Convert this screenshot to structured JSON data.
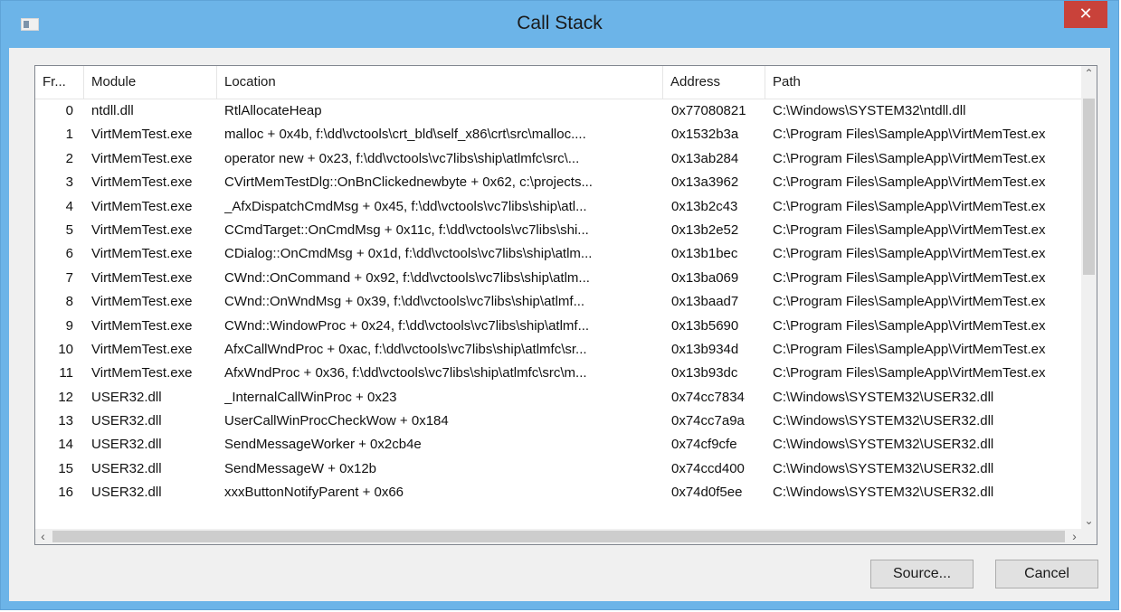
{
  "window": {
    "title": "Call Stack",
    "close_glyph": "✕",
    "icon": "window-app-icon"
  },
  "columns": [
    "Fr...",
    "Module",
    "Location",
    "Address",
    "Path"
  ],
  "rows": [
    {
      "frame": "0",
      "module": "ntdll.dll",
      "location": "RtlAllocateHeap",
      "address": "0x77080821",
      "path": "C:\\Windows\\SYSTEM32\\ntdll.dll"
    },
    {
      "frame": "1",
      "module": "VirtMemTest.exe",
      "location": "malloc + 0x4b, f:\\dd\\vctools\\crt_bld\\self_x86\\crt\\src\\malloc....",
      "address": "0x1532b3a",
      "path": "C:\\Program Files\\SampleApp\\VirtMemTest.ex"
    },
    {
      "frame": "2",
      "module": "VirtMemTest.exe",
      "location": "operator new + 0x23, f:\\dd\\vctools\\vc7libs\\ship\\atlmfc\\src\\...",
      "address": "0x13ab284",
      "path": "C:\\Program Files\\SampleApp\\VirtMemTest.ex"
    },
    {
      "frame": "3",
      "module": "VirtMemTest.exe",
      "location": "CVirtMemTestDlg::OnBnClickednewbyte + 0x62, c:\\projects...",
      "address": "0x13a3962",
      "path": "C:\\Program Files\\SampleApp\\VirtMemTest.ex"
    },
    {
      "frame": "4",
      "module": "VirtMemTest.exe",
      "location": "_AfxDispatchCmdMsg + 0x45, f:\\dd\\vctools\\vc7libs\\ship\\atl...",
      "address": "0x13b2c43",
      "path": "C:\\Program Files\\SampleApp\\VirtMemTest.ex"
    },
    {
      "frame": "5",
      "module": "VirtMemTest.exe",
      "location": "CCmdTarget::OnCmdMsg + 0x11c, f:\\dd\\vctools\\vc7libs\\shi...",
      "address": "0x13b2e52",
      "path": "C:\\Program Files\\SampleApp\\VirtMemTest.ex"
    },
    {
      "frame": "6",
      "module": "VirtMemTest.exe",
      "location": "CDialog::OnCmdMsg + 0x1d, f:\\dd\\vctools\\vc7libs\\ship\\atlm...",
      "address": "0x13b1bec",
      "path": "C:\\Program Files\\SampleApp\\VirtMemTest.ex"
    },
    {
      "frame": "7",
      "module": "VirtMemTest.exe",
      "location": "CWnd::OnCommand + 0x92, f:\\dd\\vctools\\vc7libs\\ship\\atlm...",
      "address": "0x13ba069",
      "path": "C:\\Program Files\\SampleApp\\VirtMemTest.ex"
    },
    {
      "frame": "8",
      "module": "VirtMemTest.exe",
      "location": "CWnd::OnWndMsg + 0x39, f:\\dd\\vctools\\vc7libs\\ship\\atlmf...",
      "address": "0x13baad7",
      "path": "C:\\Program Files\\SampleApp\\VirtMemTest.ex"
    },
    {
      "frame": "9",
      "module": "VirtMemTest.exe",
      "location": "CWnd::WindowProc + 0x24, f:\\dd\\vctools\\vc7libs\\ship\\atlmf...",
      "address": "0x13b5690",
      "path": "C:\\Program Files\\SampleApp\\VirtMemTest.ex"
    },
    {
      "frame": "10",
      "module": "VirtMemTest.exe",
      "location": "AfxCallWndProc + 0xac, f:\\dd\\vctools\\vc7libs\\ship\\atlmfc\\sr...",
      "address": "0x13b934d",
      "path": "C:\\Program Files\\SampleApp\\VirtMemTest.ex"
    },
    {
      "frame": "11",
      "module": "VirtMemTest.exe",
      "location": "AfxWndProc + 0x36, f:\\dd\\vctools\\vc7libs\\ship\\atlmfc\\src\\m...",
      "address": "0x13b93dc",
      "path": "C:\\Program Files\\SampleApp\\VirtMemTest.ex"
    },
    {
      "frame": "12",
      "module": "USER32.dll",
      "location": "_InternalCallWinProc + 0x23",
      "address": "0x74cc7834",
      "path": "C:\\Windows\\SYSTEM32\\USER32.dll"
    },
    {
      "frame": "13",
      "module": "USER32.dll",
      "location": "UserCallWinProcCheckWow + 0x184",
      "address": "0x74cc7a9a",
      "path": "C:\\Windows\\SYSTEM32\\USER32.dll"
    },
    {
      "frame": "14",
      "module": "USER32.dll",
      "location": "SendMessageWorker + 0x2cb4e",
      "address": "0x74cf9cfe",
      "path": "C:\\Windows\\SYSTEM32\\USER32.dll"
    },
    {
      "frame": "15",
      "module": "USER32.dll",
      "location": "SendMessageW + 0x12b",
      "address": "0x74ccd400",
      "path": "C:\\Windows\\SYSTEM32\\USER32.dll"
    },
    {
      "frame": "16",
      "module": "USER32.dll",
      "location": "xxxButtonNotifyParent + 0x66",
      "address": "0x74d0f5ee",
      "path": "C:\\Windows\\SYSTEM32\\USER32.dll"
    }
  ],
  "scroll": {
    "up": "⌃",
    "down": "⌄",
    "left": "‹",
    "right": "›"
  },
  "buttons": {
    "source": "Source...",
    "cancel": "Cancel"
  },
  "colors": {
    "titlebar": "#6cb4e8",
    "close": "#c9423a",
    "client": "#f0f0f0"
  }
}
